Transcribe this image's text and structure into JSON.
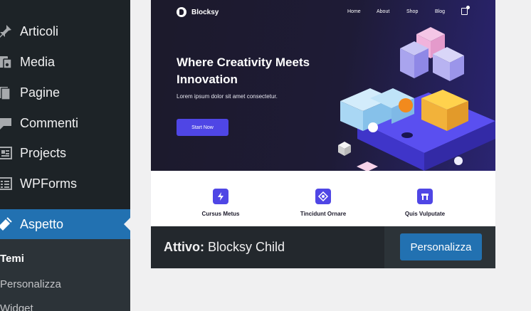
{
  "sidebar": {
    "items": [
      {
        "label": "Articoli",
        "icon": "pin-icon"
      },
      {
        "label": "Media",
        "icon": "media-icon"
      },
      {
        "label": "Pagine",
        "icon": "page-icon"
      },
      {
        "label": "Commenti",
        "icon": "comment-icon"
      },
      {
        "label": "Projects",
        "icon": "projects-icon"
      },
      {
        "label": "WPForms",
        "icon": "form-icon"
      },
      {
        "label": "Aspetto",
        "icon": "brush-icon"
      }
    ],
    "submenu": [
      {
        "label": "Temi"
      },
      {
        "label": "Personalizza"
      },
      {
        "label": "Widget"
      }
    ]
  },
  "theme": {
    "screenshot": {
      "brand": "Blocksy",
      "nav": [
        "Home",
        "About",
        "Shop",
        "Blog"
      ],
      "hero_title_line1": "Where Creativity Meets",
      "hero_title_line2": "Innovation",
      "hero_subtitle": "Lorem ipsum dolor sit amet consectetur.",
      "hero_button": "Start Now",
      "features": [
        "Cursus Metus",
        "Tincidunt Ornare",
        "Quis Vulputate"
      ]
    },
    "active_prefix": "Attivo:",
    "active_name": "Blocksy Child",
    "customize_label": "Personalizza"
  },
  "colors": {
    "sidebar_bg": "#1d2327",
    "accent": "#2271b1",
    "hero_accent": "#4f46e5"
  }
}
